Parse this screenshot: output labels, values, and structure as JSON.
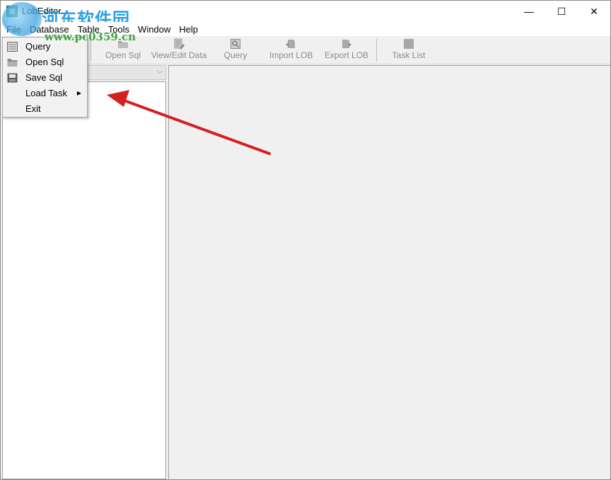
{
  "window": {
    "title": "LobEditor",
    "controls": {
      "minimize": "—",
      "maximize": "☐",
      "close": "✕"
    }
  },
  "watermark": {
    "site_name": "河东软件园",
    "url": "www.pc0359.cn"
  },
  "menubar": {
    "items": [
      {
        "label": "File"
      },
      {
        "label": "Database"
      },
      {
        "label": "Table"
      },
      {
        "label": "Tools"
      },
      {
        "label": "Window"
      },
      {
        "label": "Help"
      }
    ]
  },
  "toolbar": {
    "buttons": [
      {
        "label": "Open Sql",
        "icon": "folder-icon"
      },
      {
        "label": "View/Edit Data",
        "icon": "edit-data-icon"
      },
      {
        "label": "Query",
        "icon": "query-icon"
      },
      {
        "label": "Import LOB",
        "icon": "import-icon"
      },
      {
        "label": "Export LOB",
        "icon": "export-icon"
      },
      {
        "label": "Task List",
        "icon": "task-list-icon"
      }
    ]
  },
  "file_menu": {
    "items": [
      {
        "label": "Query",
        "icon": "query-icon"
      },
      {
        "label": "Open Sql",
        "icon": "folder-icon"
      },
      {
        "label": "Save Sql",
        "icon": "save-icon"
      },
      {
        "label": "Load Task",
        "submenu_arrow": "▶"
      },
      {
        "label": "Exit"
      }
    ]
  },
  "combo": {
    "arrow": "⌵"
  },
  "colors": {
    "annotation_arrow": "#d42020",
    "watermark_blue": "#2a9fe0",
    "watermark_green": "#3fa33f"
  }
}
